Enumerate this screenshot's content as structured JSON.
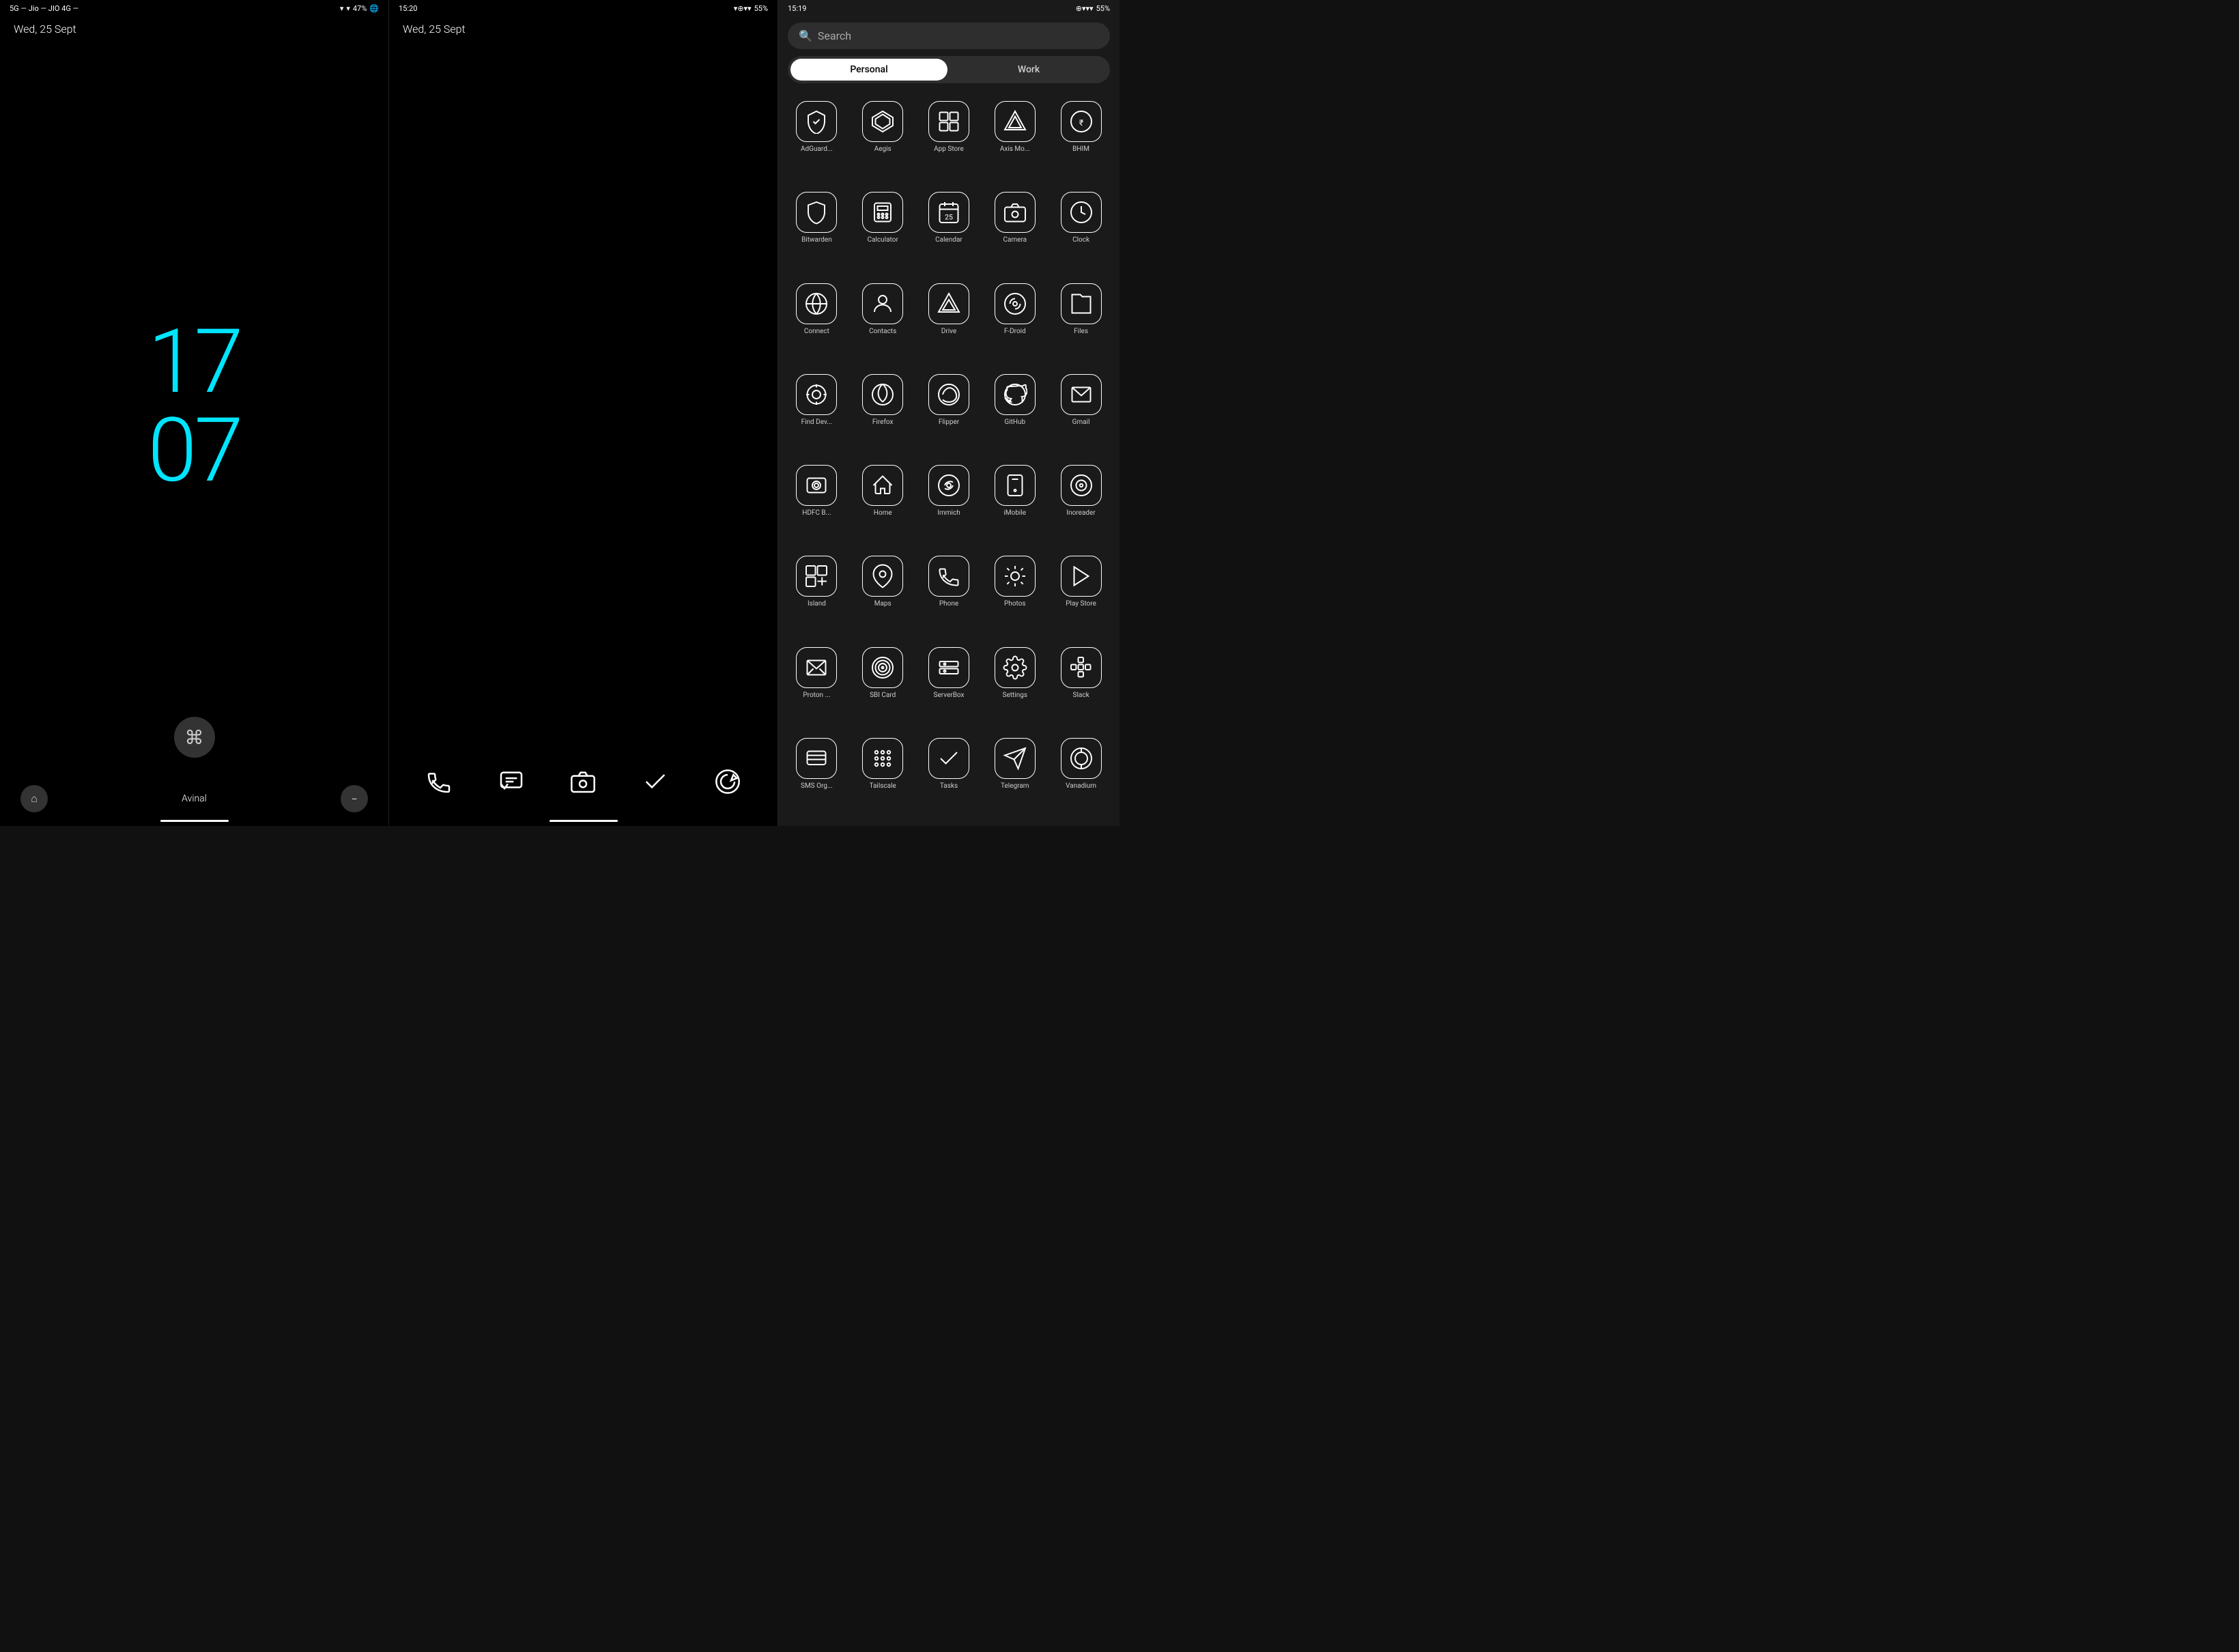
{
  "panel1": {
    "statusBar": {
      "left": "5G — Jio — JIO 4G —",
      "battery": "47%",
      "time": ""
    },
    "date": "Wed, 25 Sept",
    "clockHours": "17",
    "clockMinutes": "07",
    "navCenter": "Avinal"
  },
  "panel2": {
    "statusBar": {
      "time": "15:20",
      "battery": "55%"
    },
    "date": "Wed, 25 Sept",
    "dock": [
      "phone",
      "messages",
      "camera",
      "tasks",
      "fdroid"
    ]
  },
  "panel3": {
    "statusBar": {
      "time": "15:19",
      "battery": "55%"
    },
    "search": {
      "placeholder": "Search"
    },
    "tabs": {
      "personal": "Personal",
      "work": "Work",
      "activeTab": "personal"
    },
    "apps": [
      {
        "label": "AdGuard...",
        "icon": "adguard"
      },
      {
        "label": "Aegis",
        "icon": "aegis"
      },
      {
        "label": "App Store",
        "icon": "appstore"
      },
      {
        "label": "Axis Mo...",
        "icon": "axis"
      },
      {
        "label": "BHIM",
        "icon": "bhim"
      },
      {
        "label": "Bitwarden",
        "icon": "bitwarden"
      },
      {
        "label": "Calculator",
        "icon": "calculator"
      },
      {
        "label": "Calendar",
        "icon": "calendar"
      },
      {
        "label": "Camera",
        "icon": "camera"
      },
      {
        "label": "Clock",
        "icon": "clock"
      },
      {
        "label": "Connect",
        "icon": "connect"
      },
      {
        "label": "Contacts",
        "icon": "contacts"
      },
      {
        "label": "Drive",
        "icon": "drive"
      },
      {
        "label": "F-Droid",
        "icon": "fdroid"
      },
      {
        "label": "Files",
        "icon": "files"
      },
      {
        "label": "Find Dev...",
        "icon": "finddev"
      },
      {
        "label": "Firefox",
        "icon": "firefox"
      },
      {
        "label": "Flipper",
        "icon": "flipper"
      },
      {
        "label": "GitHub",
        "icon": "github"
      },
      {
        "label": "Gmail",
        "icon": "gmail"
      },
      {
        "label": "HDFC B...",
        "icon": "hdfc"
      },
      {
        "label": "Home",
        "icon": "home"
      },
      {
        "label": "Immich",
        "icon": "immich"
      },
      {
        "label": "iMobile",
        "icon": "imobile"
      },
      {
        "label": "Inoreader",
        "icon": "inoreader"
      },
      {
        "label": "Island",
        "icon": "island"
      },
      {
        "label": "Maps",
        "icon": "maps"
      },
      {
        "label": "Phone",
        "icon": "phone"
      },
      {
        "label": "Photos",
        "icon": "photos"
      },
      {
        "label": "Play Store",
        "icon": "playstore"
      },
      {
        "label": "Proton ...",
        "icon": "proton"
      },
      {
        "label": "SBI Card",
        "icon": "sbicard"
      },
      {
        "label": "ServerBox",
        "icon": "serverbox"
      },
      {
        "label": "Settings",
        "icon": "settings"
      },
      {
        "label": "Slack",
        "icon": "slack"
      },
      {
        "label": "SMS Org...",
        "icon": "smsorg"
      },
      {
        "label": "Tailscale",
        "icon": "tailscale"
      },
      {
        "label": "Tasks",
        "icon": "tasks"
      },
      {
        "label": "Telegram",
        "icon": "telegram"
      },
      {
        "label": "Vanadium",
        "icon": "vanadium"
      }
    ]
  }
}
